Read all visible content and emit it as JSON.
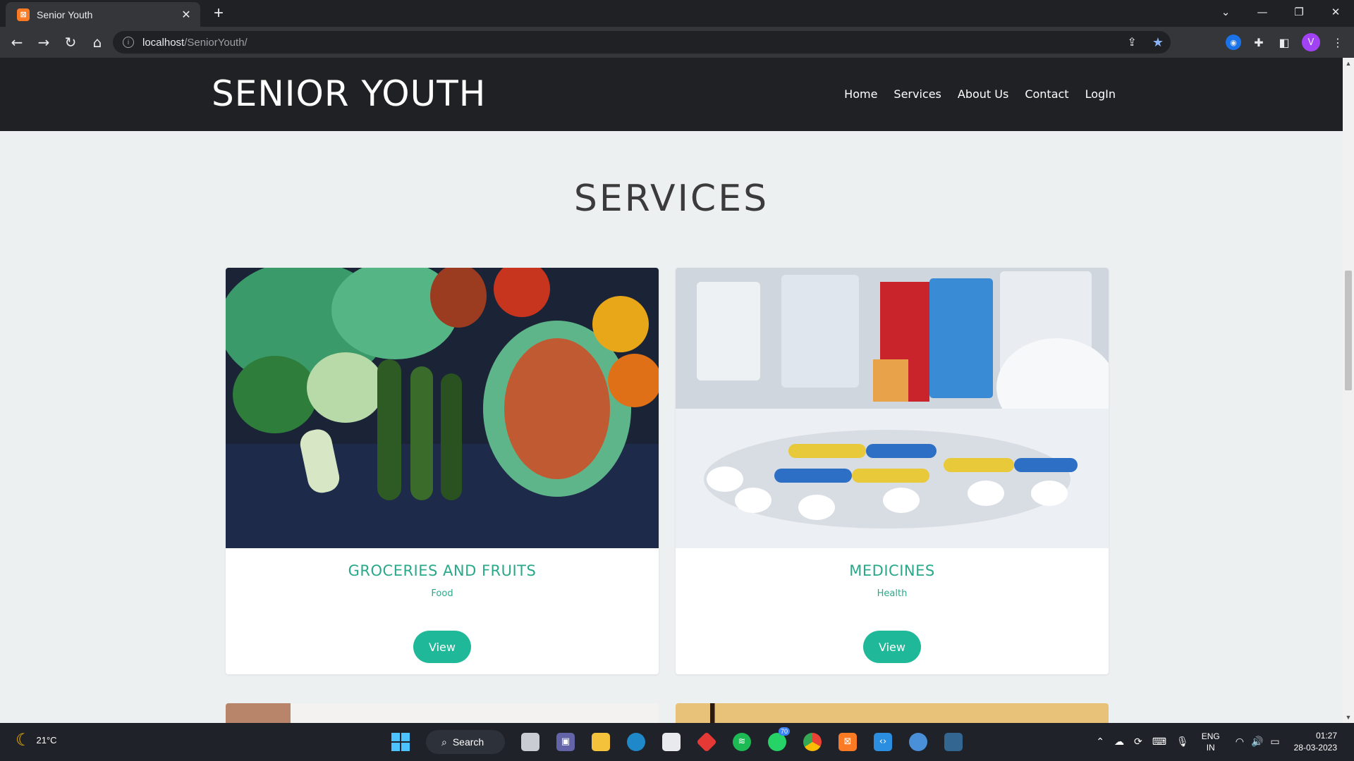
{
  "browser": {
    "tab_title": "Senior Youth",
    "favicon": "xampp-icon",
    "url_host": "localhost",
    "url_path": "/SeniorYouth/",
    "profile_initial": "V"
  },
  "site": {
    "logo": "SENIOR YOUTH",
    "nav": [
      "Home",
      "Services",
      "About Us",
      "Contact",
      "LogIn"
    ],
    "section_title": "SERVICES",
    "cards": [
      {
        "title": "GROCERIES AND FRUITS",
        "category": "Food",
        "button": "View",
        "image": "vegetables-photo"
      },
      {
        "title": "MEDICINES",
        "category": "Health",
        "button": "View",
        "image": "pills-photo"
      }
    ],
    "accent_color": "#1fb999",
    "header_color": "#202124"
  },
  "taskbar": {
    "weather_temp": "21°C",
    "search_label": "Search",
    "whatsapp_badge": "70",
    "lang_line1": "ENG",
    "lang_line2": "IN",
    "time": "01:27",
    "date": "28-03-2023"
  }
}
